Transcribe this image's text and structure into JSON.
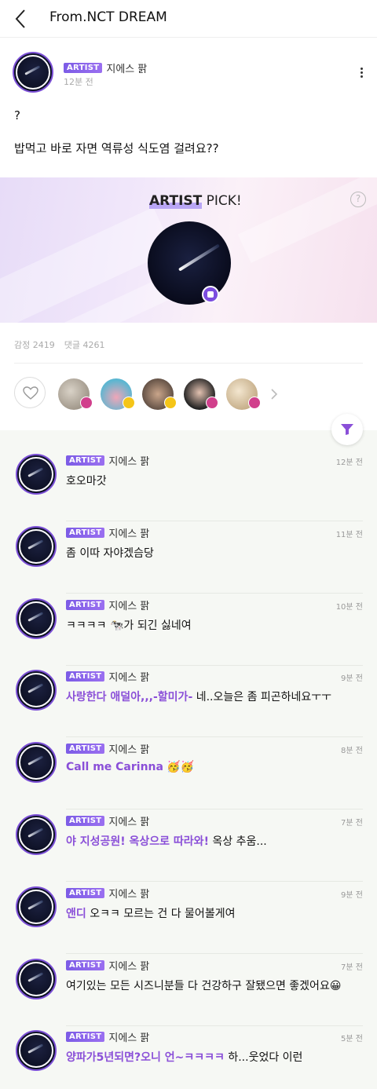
{
  "header": {
    "title": "From.NCT DREAM"
  },
  "post": {
    "badge": "ARTIST",
    "author": "지에스 팕",
    "time": "12분 전",
    "line1": "?",
    "line2": "밥먹고 바로 자면 역류성 식도염 걸려요??"
  },
  "pick": {
    "title_bold": "ARTIST",
    "title_rest": " PICK!",
    "help": "?"
  },
  "stats": {
    "emotion": "감정 2419",
    "comments": "댓글 4261"
  },
  "reactions": {
    "fans": [
      {
        "name": "fan-1",
        "badge": "heart"
      },
      {
        "name": "fan-2",
        "badge": "smile"
      },
      {
        "name": "fan-3",
        "badge": "smile"
      },
      {
        "name": "fan-4",
        "badge": "heart"
      },
      {
        "name": "fan-5",
        "badge": "heart"
      }
    ],
    "more_icon": "chevron-right-icon"
  },
  "comments": [
    {
      "badge": "ARTIST",
      "author": "지에스 팕",
      "time": "12분 전",
      "mention": "",
      "text": "호오마갓"
    },
    {
      "badge": "ARTIST",
      "author": "지에스 팕",
      "time": "11분 전",
      "mention": "",
      "text": "좀 이따 자야겠슴당"
    },
    {
      "badge": "ARTIST",
      "author": "지에스 팕",
      "time": "10분 전",
      "mention": "",
      "text": "ㅋㅋㅋㅋ 🐄가 되긴 싫네여"
    },
    {
      "badge": "ARTIST",
      "author": "지에스 팕",
      "time": "9분 전",
      "mention": "사랑한다 애덜아,,,-할미가-",
      "text": " 네..오늘은 좀 피곤하네요ㅜㅜ"
    },
    {
      "badge": "ARTIST",
      "author": "지에스 팕",
      "time": "8분 전",
      "mention": "Call me Carinna",
      "text": " 🥳🥳"
    },
    {
      "badge": "ARTIST",
      "author": "지에스 팕",
      "time": "7분 전",
      "mention": "야 지성공원! 옥상으로 따라와!",
      "text": " 옥상 추움..."
    },
    {
      "badge": "ARTIST",
      "author": "지에스 팕",
      "time": "9분 전",
      "mention": "앤디",
      "text": " 오ㅋㅋ 모르는 건 다 물어볼게여"
    },
    {
      "badge": "ARTIST",
      "author": "지에스 팕",
      "time": "7분 전",
      "mention": "",
      "text": "여기있는 모든 시즈니분들 다 건강하구 잘됐으면 좋겠어요😀"
    },
    {
      "badge": "ARTIST",
      "author": "지에스 팕",
      "time": "5분 전",
      "mention": "양파가5년되면?오니 언~ㅋㅋㅋㅋ",
      "text": " 하...웃었다 이런"
    }
  ],
  "colors": {
    "accent": "#8a4fd8",
    "badge": "#7c5ce6",
    "comments_bg": "#f6f8f4"
  }
}
